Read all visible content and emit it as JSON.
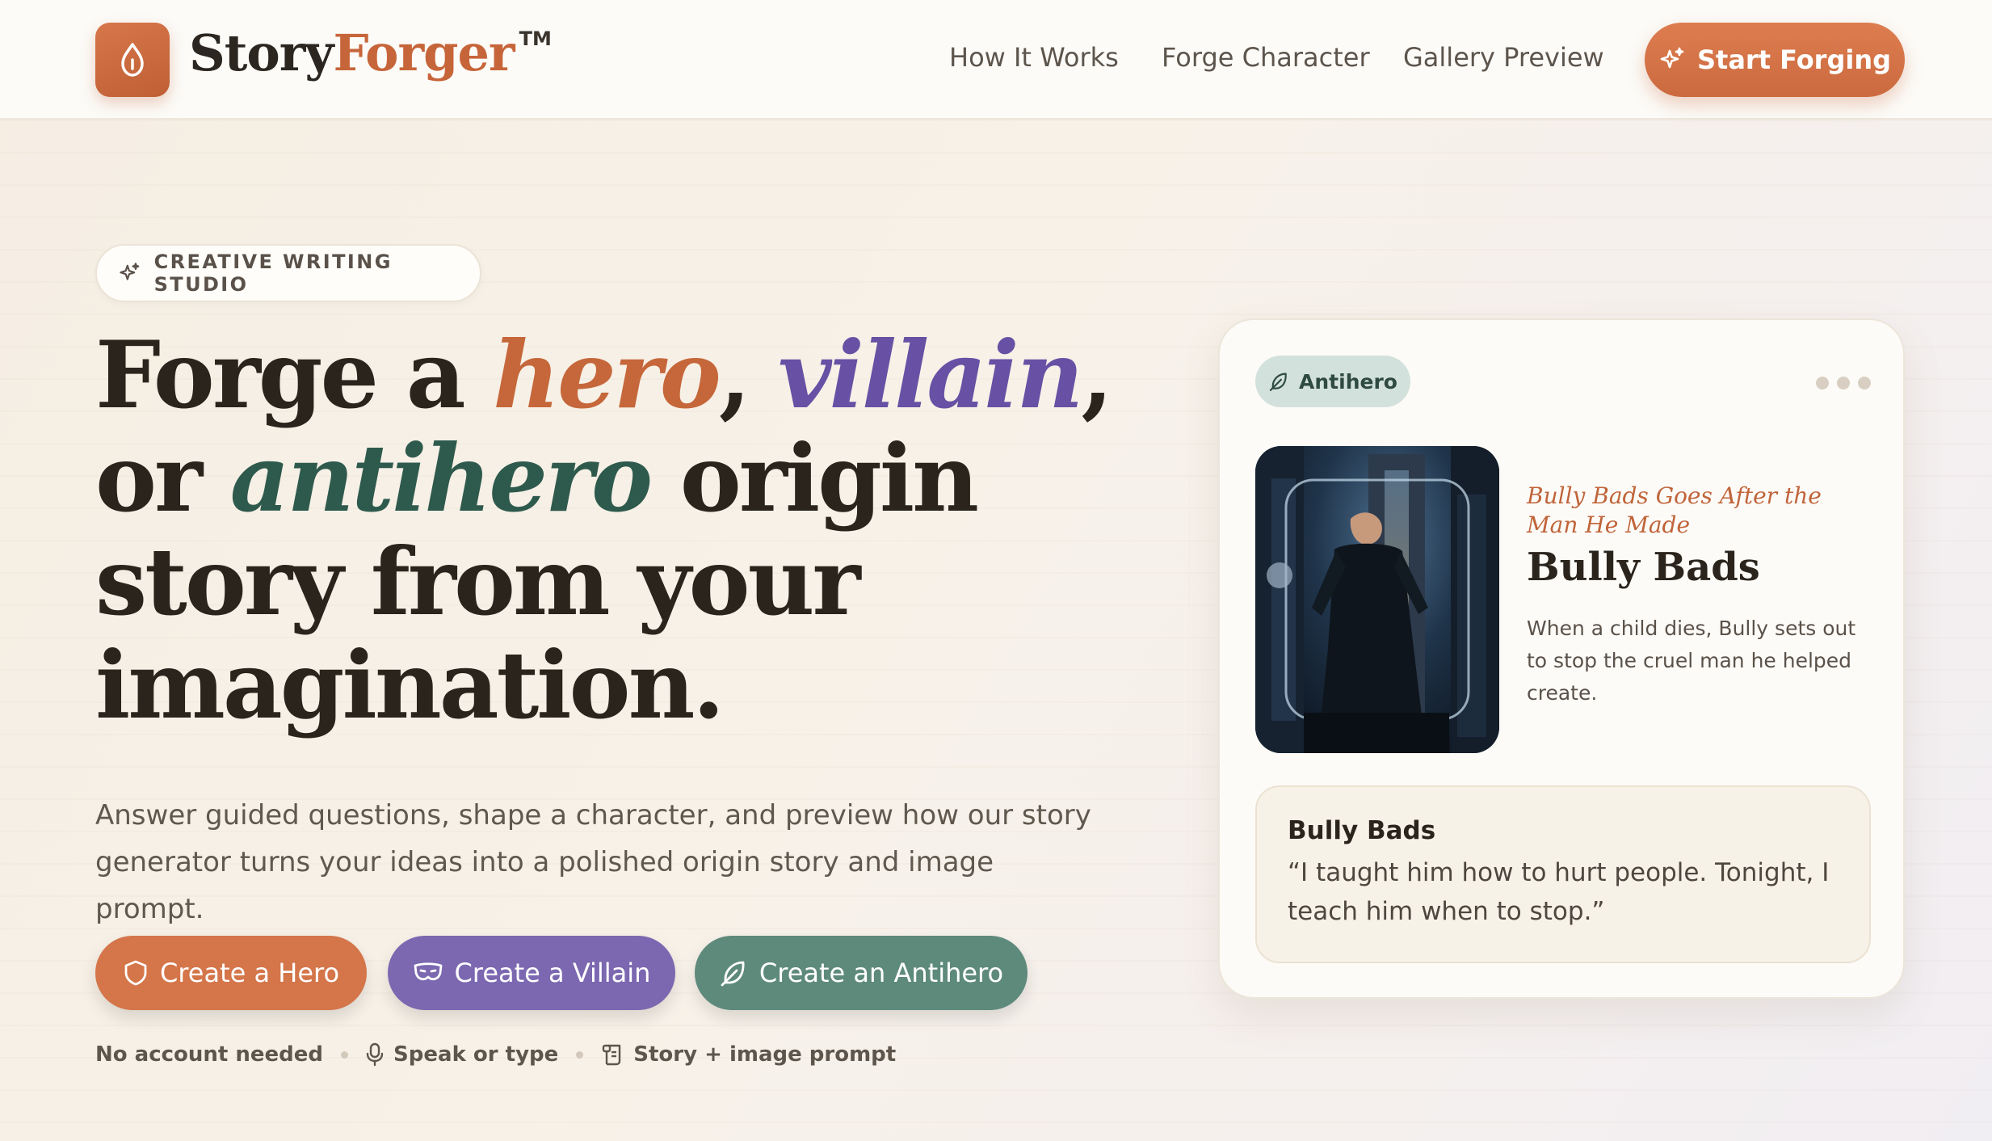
{
  "brand": {
    "name_part1": "Story",
    "name_part2": "Forger",
    "trademark": "TM",
    "accent": "#c7653a"
  },
  "nav": {
    "items": [
      {
        "label": "How It Works"
      },
      {
        "label": "Forge Character"
      },
      {
        "label": "Gallery Preview"
      }
    ],
    "cta_label": "Start Forging",
    "cta_icon": "sparkles-icon"
  },
  "hero": {
    "badge": "CREATIVE WRITING STUDIO",
    "badge_icon": "sparkles-icon",
    "headline": {
      "part1": "Forge a ",
      "hero": "hero",
      "sep1": ", ",
      "villain": "villain",
      "sep2": ",",
      "part2": "or ",
      "antihero": "antihero",
      "part3": " origin story from your imagination."
    },
    "subtitle": "Answer guided questions, shape a character, and preview how our story generator turns your ideas into a polished origin story and image prompt.",
    "buttons": [
      {
        "label": "Create a Hero",
        "icon": "shield-icon",
        "color": "#d4754a"
      },
      {
        "label": "Create a Villain",
        "icon": "mask-icon",
        "color": "#7b68b0"
      },
      {
        "label": "Create an Antihero",
        "icon": "feather-icon",
        "color": "#5e8a7c"
      }
    ],
    "meta": [
      {
        "label": "No account needed"
      },
      {
        "label": "Speak or type",
        "icon": "microphone-icon"
      },
      {
        "label": "Story + image prompt",
        "icon": "scroll-icon"
      }
    ]
  },
  "preview_card": {
    "tag": "Antihero",
    "tag_icon": "feather-icon",
    "story_title": "Bully Bads Goes After the Man He Made",
    "character_name": "Bully Bads",
    "description": "When a child dies, Bully sets out to stop the cruel man he helped create.",
    "quote_speaker": "Bully Bads",
    "quote_text": "“I taught him how to hurt people. Tonight, I teach him when to stop.”"
  }
}
